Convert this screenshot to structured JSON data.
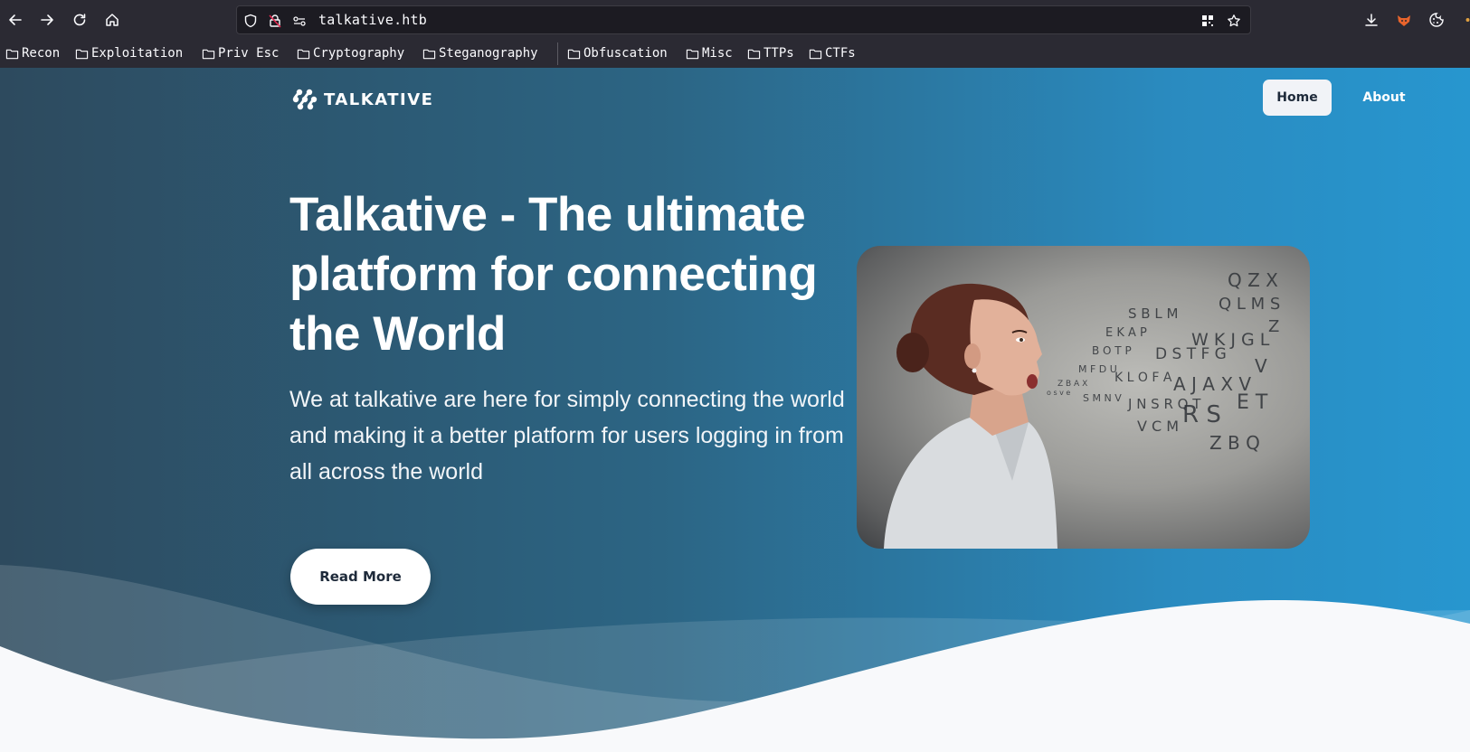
{
  "browser": {
    "url": "talkative.htb",
    "bookmarks": [
      "Recon",
      "Exploitation",
      "Priv Esc",
      "Cryptography",
      "Steganography",
      "Obfuscation",
      "Misc",
      "TTPs",
      "CTFs"
    ]
  },
  "nav": {
    "brand": "TALKATIVE",
    "links": [
      "Home",
      "About"
    ],
    "active": "Home"
  },
  "hero": {
    "title": "Talkative - The ultimate platform for connecting the World",
    "text": "We at talkative are here for simply connecting the world and making it a better platform for users logging in from all across the world",
    "cta_label": "Read More",
    "image_icon": "woman-speaking-letters-photo"
  },
  "colors": {
    "gradient_start": "#2d4a5e",
    "gradient_end": "#2796cf",
    "button_bg": "#ffffff",
    "chrome_bg": "#2b2a33"
  }
}
